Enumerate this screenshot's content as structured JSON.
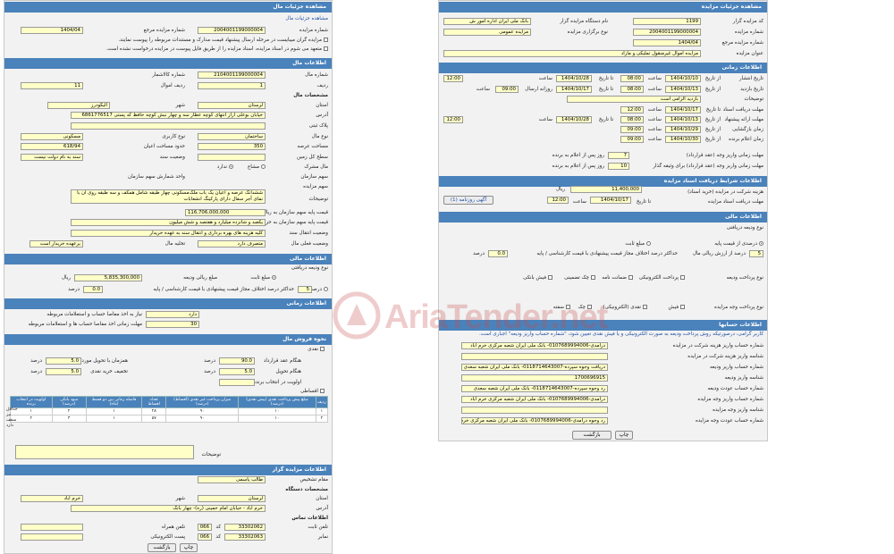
{
  "left": {
    "auction_details": {
      "header": "مشاهده جزئیات مال",
      "breadcrumb": "مشاهده جزئیات مال",
      "auction_number_label": "شماره مزایده",
      "auction_number": "2004001199000004",
      "ref_number_label": "شماره مزایده مرجع",
      "ref_number": "1404/04",
      "check1": "مزایده گران میبایست در مرحله ارسال پیشنهاد قیمت مدارک و مستندات مربوطه را پیوست نمایند.",
      "check2": "متعهد می شوم در اسناد مزایده، اسناد مزایده را از طریق فایل پیوست در مزایده درخواست نشده است."
    },
    "property_info": {
      "header": "اطلاعات مال",
      "property_number_label": "شماره مال",
      "property_number": "2104001199000004",
      "kala_number_label": "شماره کالاشمار",
      "row_number_label": "ردیف",
      "row_number": "1",
      "property_row_label": "ردیف اموال",
      "property_row": "11",
      "location_header": "مشخصات مال",
      "province_label": "استان",
      "province": "لرستان",
      "city_label": "شهر",
      "city": "الیگودرز",
      "address_label": "آدرس",
      "address": "خیابان بوعلی اراز انتهای کوچه عطار سه و چهار نبش کوچه حافظ کد پستی 6861776517",
      "plaque_label": "پلاک ثبتی",
      "property_type_label": "نوع مال",
      "property_type": "ساختمان",
      "usage_type_label": "نوع کاربری",
      "usage_type": "مسکونی",
      "area_label": "مساحت عرصه",
      "area": "350",
      "building_area_label": "حدود مساحت اعیان",
      "building_area": "618/94",
      "floors_label": "سطح کل زمین",
      "status_label": "وضعیت سند",
      "status": "سند به نام دولت نیست",
      "joint_label": "مال مشرک",
      "joint_yes": "مشاع",
      "joint_no": "ندارد",
      "share_label": "سهم سازمان",
      "share_unit_label": "واحد شمارش سهم سازمان",
      "share_total_label": "سهم مزایده",
      "description_label": "توضیحات",
      "description": "ششدانگ عرصه و اعیان یک باب ملک‌مسکونی چهار طبقه شامل همکف و سه طبقه روی آن با نمای آجر سفال دارای پارکینگ انشعابات",
      "base_price_label": "قیمت پایه سهم سازمان به ریال",
      "base_price": "116,706,000,000",
      "base_price_words_label": "قیمت پایه سهم سازمان به حروف",
      "base_price_words": "یکصد و شانزده میلیارد و هفتصد و شش میلیون",
      "transfer_label": "وضعیت انتقال سند",
      "transfer": "کلیه هزینه های بهره برداری و انتقال سند به عهده خریدار",
      "current_status_label": "وضعیت فعلی مال",
      "current_status": "متصرف دارد",
      "evacuation_label": "تخلیه مال",
      "evacuation": "برعهده خریدار است"
    },
    "deposit": {
      "header": "اطلاعات مالی",
      "type_label": "نوع ودیعه دریافتی",
      "fixed_label": "مبلغ ثابت",
      "amount_label": "مبلغ ریالی ودیعه",
      "amount": "5,835,300,000",
      "currency": "ریال",
      "percent_label": "درصد از قیمت پایه",
      "percent": "5",
      "max_diff_label": "حداکثر درصد اختلاف مجاز قیمت پیشنهادی با قیمت کارشناسی / پایه",
      "max_diff": "0.0",
      "percent_unit": "درصد"
    },
    "time_info": {
      "header": "اطلاعات زمانی",
      "need_label": "نیاز به اخذ مفاصا حساب و استعلامات مربوطه",
      "need_value": "دارد",
      "deadline_label": "مهلت زمانی اخذ مفاصا حساب ها و استعلامات مربوطه",
      "deadline_value": "30"
    },
    "sale_method": {
      "header": "نحوه فروش مال",
      "cash_label": "نقدی",
      "contract_label": "هنگام عقد قرارداد",
      "contract_value": "90.0",
      "with_label": "همزمان با تحویل مورد معامله",
      "with_value": "5.0",
      "delivery_label": "هنگام تحویل",
      "delivery_value": "5.0",
      "discount_label": "تخفیف خرید نقدی",
      "discount_value": "5.0",
      "priority_label": "اولویت در انتخاب برنده",
      "installment_label": "اقساطی",
      "percent_unit": "درصد",
      "table_headers": [
        "ردیف",
        "مبلغ پیش پرداخت نقدی (پیش نقدی) (درصد)",
        "میزان پرداخت غیر نقدی (اقساط) (درصد)",
        "تعداد اقساط",
        "فاصله زمانی بین دو قسط (ماه)",
        "سود بانکی (درصد)",
        "اولویت در انتخاب برنده"
      ],
      "table_rows": [
        [
          "۱",
          "۱۰",
          "۹۰",
          "۲۸",
          "۱",
          "۲",
          "۱"
        ],
        [
          "۲",
          "۱۰",
          "۹۰",
          "۵۷",
          "۱",
          "۳",
          "۲"
        ]
      ],
      "side_labels": [
        "حداقل",
        "نیز",
        "سقف",
        "دارد"
      ],
      "notes_label": "توضیحات"
    },
    "organizer": {
      "header": "اطلاعات مزایده گزار",
      "authority_label": "مقام تشخیص",
      "authority": "طالب یاسمی",
      "org_header": "مشخصات دستگاه",
      "province_label": "استان",
      "province": "لرستان",
      "city_label": "شهر",
      "city": "خرم آباد",
      "address_label": "آدرس",
      "address": "خرم آباد - خیابان امام خمینی (ره)- چهار بانک",
      "contact_header": "اطلاعات تماس",
      "phone_label": "تلفن ثابت",
      "phone": "33302062",
      "phone_code": "066",
      "mobile_label": "تلفن همراه",
      "fax_label": "نمابر",
      "fax": "33302063",
      "fax_code": "066",
      "email_label": "پست الکترونیکی",
      "code_label": "کد"
    },
    "buttons": {
      "back": "بازگشت",
      "print": "چاپ"
    }
  },
  "right": {
    "auction_details": {
      "header": "مشاهده جزئیات مزایده",
      "organizer_code_label": "کد مزایده گزار",
      "organizer_code": "1199",
      "device_label": "نام دستگاه مزایده گزار",
      "device": "بانک ملی ایران اداره امور ش",
      "auction_number_label": "شماره مزایده",
      "auction_number": "2004001199000004",
      "holding_label": "نوع برگزاری مزایده",
      "holding": "مزایده عمومی",
      "ref_label": "شماره مزایده مرجع",
      "ref": "1404/04",
      "title_label": "عنوان مزایده",
      "title": "مزایده اموال غیرمنقول تملیکی و مازاد"
    },
    "time_info": {
      "header": "اطلاعات زمانی",
      "publish_label": "تاریخ انتشار",
      "publish_date": "1404/10/10",
      "publish_time": "08:00",
      "publish_to_date": "1404/10/28",
      "publish_to_time": "12:00",
      "visit_label": "تاریخ بازدید",
      "visit_date": "1404/10/13",
      "visit_time": "08:00",
      "visit_to_date": "1404/10/17",
      "visit_days": "روزانه ارسال",
      "visit_to_time": "09:00",
      "address_label": "توضیحات",
      "address": "بازدید الزامی است",
      "doc_deadline_label": "مهلت دریافت اسناد",
      "doc_date": "1404/10/17",
      "doc_time": "12:00",
      "bid_deadline_label": "مهلت ارائه پیشنهاد",
      "bid_date": "1404/10/13",
      "bid_time": "08:00",
      "bid_to_date": "1404/10/28",
      "bid_to_time": "12:00",
      "opening_label": "زمان بازگشایی",
      "opening_date": "1404/10/29",
      "opening_time": "09:00",
      "announce_label": "زمان اعلام برنده",
      "announce_date": "1404/10/30",
      "announce_time": "09:00",
      "from_date": "از تاریخ",
      "to_date": "تا تاریخ",
      "time_label": "ساعت",
      "pay_deadline_label": "مهلت زمانی واریز وجه (عقد قرارداد)",
      "pay_deadline": "7",
      "pay_deadline_suffix": "روز پس از اعلام به برنده",
      "guarantee_deadline_label": "مهلت زمانی واریز وجه (عقد قرارداد) برای وثیقه گذار",
      "guarantee_deadline": "10",
      "guarantee_suffix": "روز پس از اعلام به برنده"
    },
    "docs": {
      "header": "اطلاعات شرایط دریافت اسناد مزایده",
      "fee_label": "هزینه شرکت در مزایده (خرید اسناد)",
      "fee": "11,400,000",
      "currency": "ریال",
      "deadline_label": "مهلت دریافت اسناد مزایده",
      "deadline_date": "1404/10/17",
      "deadline_time": "12:00",
      "ad_button": "آگهی روزنامه (1)"
    },
    "financial": {
      "header": "اطلاعات مالی",
      "deposit_type_label": "نوع ودیعه دریافتی",
      "fixed_label": "مبلغ ثابت",
      "percent_label": "درصدی از قیمت پایه",
      "percent": "5",
      "percent_suffix": "درصد از ارزش ریالی مال",
      "max_diff_label": "حداکثر درصد اختلاف مجاز قیمت پیشنهادی با قیمت کارشناسی / پایه",
      "max_diff": "0.0",
      "percent_unit": "درصد",
      "deposit_pay_label": "نوع پرداخت ودیعه",
      "deposit_opts": [
        "پرداخت الکترونیکی",
        "ضمانت نامه",
        "چک تضمینی",
        "فیش بانکی"
      ],
      "fee_pay_label": "نوع پرداخت وجه مزایده",
      "fee_opts": [
        "فیش",
        "نقدی (الکترونیکی)",
        "چک",
        "سفته"
      ]
    },
    "accounts": {
      "header": "اطلاعات حسابها",
      "notice": "کاربر گرامی، درصورتیکه روش پرداخت ودیعه به صورت الکترونیکی و یا فیش نقدی تعیین شود، \"شماره حساب واریز ودیعه\" اجباری است.",
      "fee_account_label": "شماره حساب واریز هزینه شرکت در مزایده",
      "fee_account": "درآمدی-0107689994006- بانک ملی ایران شعبه مرکزی خرم آباد",
      "fee_id_label": "شناسه واریز هزینه شرکت در مزایده",
      "deposit_account_label": "شماره حساب واریز ودیعه",
      "deposit_account": "دریافت وجوه سپرده-0118714643007- بانک ملی ایران شعبه سعدی",
      "deposit_id_label": "شناسه واریز ودیعه",
      "deposit_id": "1700696915",
      "return_account_label": "شماره حساب عودت ودیعه",
      "return_account": "رد وجوه سپرده-0118714643007- بانک ملی ایران شعبه سعدی",
      "income_account_label": "شماره حساب واریز وجه مزایده",
      "income_account": "درآمدی-0107689994006- بانک ملی ایران شعبه مرکزی خرم آباد",
      "income_id_label": "شناسه واریز وجه مزایده",
      "refund_account_label": "شماره حساب عودت وجه مزایده",
      "refund_account": "رد وجوه درآمدی-0107689994006- بانک ملی ایران شعبه مرکزی خرم آباد"
    },
    "buttons": {
      "back": "بازگشت",
      "print": "چاپ"
    }
  },
  "watermark": "AriaTender.net",
  "colors": {
    "section_header": "#4a82bb",
    "input_bg": "#ffffc8",
    "panel_bg": "#f2f2f2",
    "watermark": "#c94b4b"
  }
}
